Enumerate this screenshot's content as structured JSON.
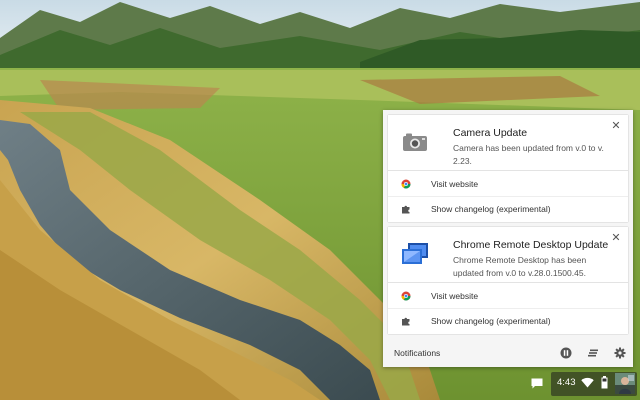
{
  "notifications": [
    {
      "icon": "camera-icon",
      "title": "Camera Update",
      "message": "Camera has been updated from v.0 to v. 2.23.",
      "actions": [
        {
          "icon": "chrome-icon",
          "label": "Visit website"
        },
        {
          "icon": "puzzle-piece-icon",
          "label": "Show changelog (experimental)"
        }
      ]
    },
    {
      "icon": "remote-desktop-icon",
      "title": "Chrome Remote Desktop Update",
      "message": "Chrome Remote Desktop has been updated from v.0 to v.28.0.1500.45.",
      "actions": [
        {
          "icon": "chrome-icon",
          "label": "Visit website"
        },
        {
          "icon": "puzzle-piece-icon",
          "label": "Show changelog (experimental)"
        }
      ]
    }
  ],
  "footer": {
    "label": "Notifications",
    "buttons": [
      "pause-icon",
      "clear-all-icon",
      "settings-gear-icon"
    ]
  },
  "shelf": {
    "time": "4:43",
    "icons": [
      "notifications-chat-icon",
      "wifi-icon",
      "battery-icon",
      "avatar"
    ]
  },
  "colors": {
    "panel_bg": "#f5f5f5",
    "card_bg": "#ffffff",
    "remote_desktop_blue": "#2b6fd6",
    "camera_grey": "#8a8a8a"
  }
}
